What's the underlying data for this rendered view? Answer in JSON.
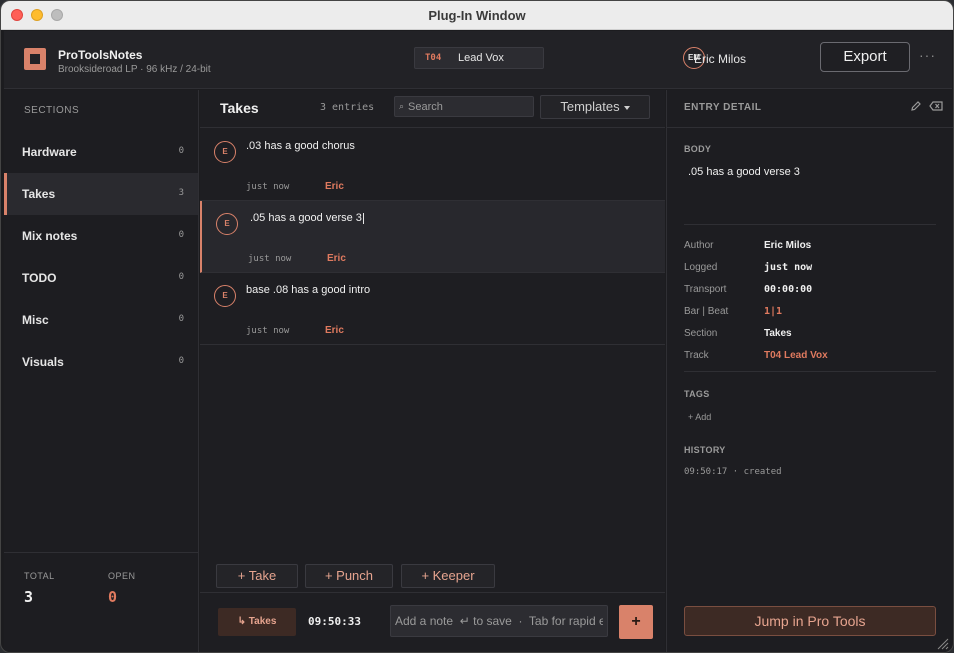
{
  "window": {
    "title": "Plug-In Window"
  },
  "header": {
    "app_name": "ProToolsNotes",
    "subtitle": "Brooksideroad LP · 96 kHz / 24-bit",
    "track_code": "T04",
    "track_name": "Lead Vox",
    "user_initials": "EM",
    "user_name": "Eric Milos",
    "export_label": "Export",
    "more_label": "···"
  },
  "sidebar": {
    "heading": "SECTIONS",
    "items": [
      {
        "label": "Hardware",
        "count": "0"
      },
      {
        "label": "Takes",
        "count": "3"
      },
      {
        "label": "Mix notes",
        "count": "0"
      },
      {
        "label": "TODO",
        "count": "0"
      },
      {
        "label": "Misc",
        "count": "0"
      },
      {
        "label": "Visuals",
        "count": "0"
      }
    ],
    "total_label": "TOTAL",
    "total_value": "3",
    "open_label": "OPEN",
    "open_value": "0"
  },
  "center": {
    "title": "Takes",
    "entry_count": "3 entries",
    "search_placeholder": "Search",
    "search_icon": "⌕",
    "templates_label": "Templates",
    "entries": [
      {
        "initial": "E",
        "text": ".03 has a good chorus",
        "time": "just now",
        "author": "Eric"
      },
      {
        "initial": "E",
        "text": ".05 has a good verse 3",
        "time": "just now",
        "author": "Eric"
      },
      {
        "initial": "E",
        "text": "base .08 has a good intro",
        "time": "just now",
        "author": "Eric"
      }
    ],
    "quick_buttons": [
      "+ Take",
      "+ Punch",
      "+ Keeper"
    ],
    "footer": {
      "section_chip": "↳ Takes",
      "clock": "09:50:33",
      "note_placeholder": "Add a note  ↵ to save  ·  Tab for rapid entry",
      "add_label": "+"
    }
  },
  "detail": {
    "title": "ENTRY DETAIL",
    "body_label": "BODY",
    "body_text": ".05 has a good verse 3",
    "fields": [
      {
        "key": "Author",
        "value": "Eric Milos"
      },
      {
        "key": "Logged",
        "value": "just now"
      },
      {
        "key": "Transport",
        "value": "00:00:00"
      },
      {
        "key": "Bar | Beat",
        "value": "1|1"
      },
      {
        "key": "Section",
        "value": "Takes"
      },
      {
        "key": "Track",
        "value": "T04 Lead Vox"
      }
    ],
    "tags_label": "TAGS",
    "add_tag_label": "+ Add",
    "history_label": "HISTORY",
    "history_line": "09:50:17  ·  created",
    "jump_label": "Jump in Pro Tools"
  },
  "colors": {
    "accent": "#d9826a",
    "accent_text": "#e07a5f",
    "background": "#1c1c1f"
  }
}
